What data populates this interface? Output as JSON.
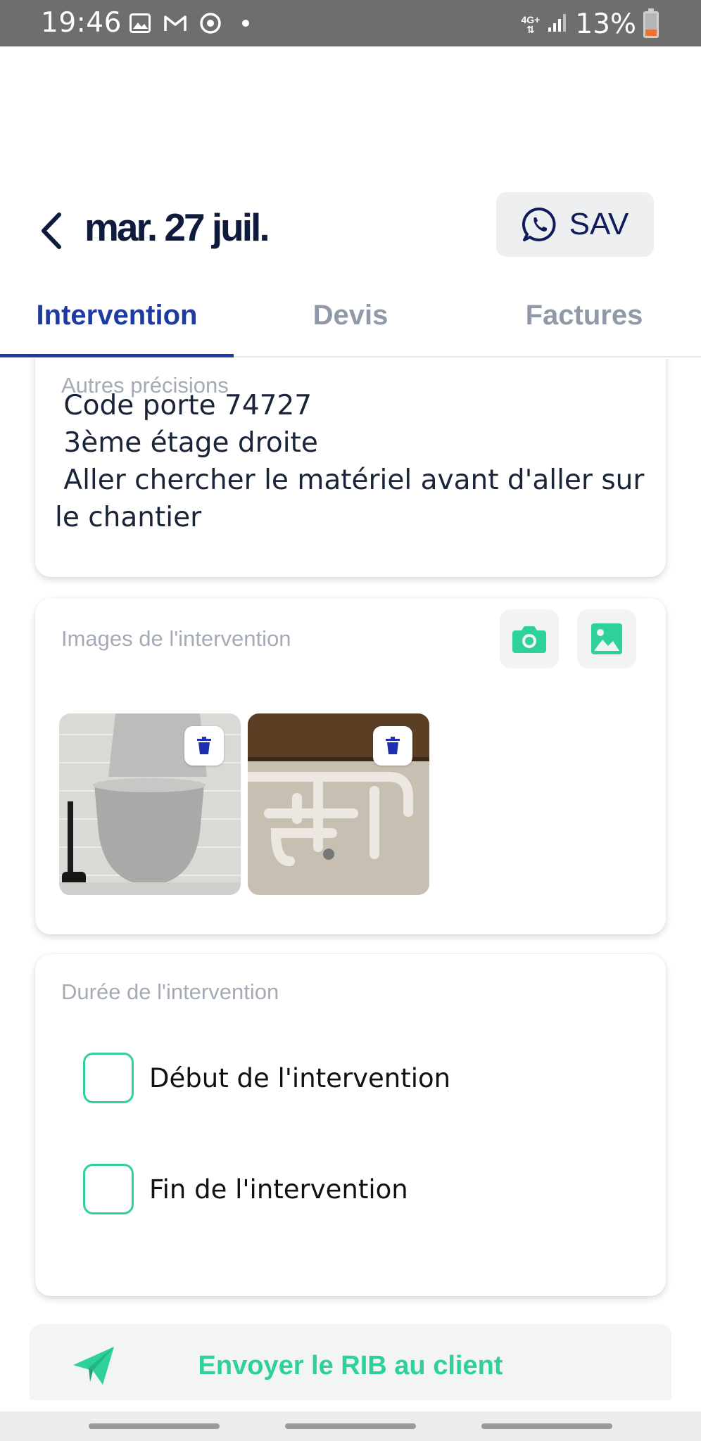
{
  "status_bar": {
    "time": "19:46",
    "network": "4G+",
    "battery": "13%",
    "battery_level": 0.13,
    "icons": [
      "image-icon",
      "gmail-icon",
      "sync-icon",
      "dot-icon"
    ]
  },
  "header": {
    "back_icon": "chevron-left-icon",
    "date": "mar. 27 juil.",
    "sav_button": {
      "icon": "whatsapp-icon",
      "label": "SAV"
    }
  },
  "tabs": [
    {
      "label": "Intervention",
      "active": true
    },
    {
      "label": "Devis",
      "active": false
    },
    {
      "label": "Factures",
      "active": false
    }
  ],
  "notes": {
    "label": "Autres précisions",
    "text": " Code porte 74727\n 3ème étage droite\n Aller chercher le matériel avant d'aller sur le chantier"
  },
  "images": {
    "label": "Images de l'intervention",
    "actions": [
      "camera-icon",
      "gallery-icon"
    ],
    "thumbnails": [
      {
        "subject": "toilet",
        "delete_icon": "trash-icon"
      },
      {
        "subject": "pipes",
        "delete_icon": "trash-icon"
      }
    ]
  },
  "duree": {
    "label": "Durée de l'intervention",
    "items": [
      {
        "label": "Début de l'intervention",
        "checked": false
      },
      {
        "label": "Fin de l'intervention",
        "checked": false
      }
    ]
  },
  "rib_button": {
    "icon": "send-icon",
    "label": "Envoyer le RIB au client"
  },
  "colors": {
    "accent_green": "#2ed19a",
    "primary_blue": "#1f3aa0",
    "title_navy": "#0f1b3d"
  }
}
